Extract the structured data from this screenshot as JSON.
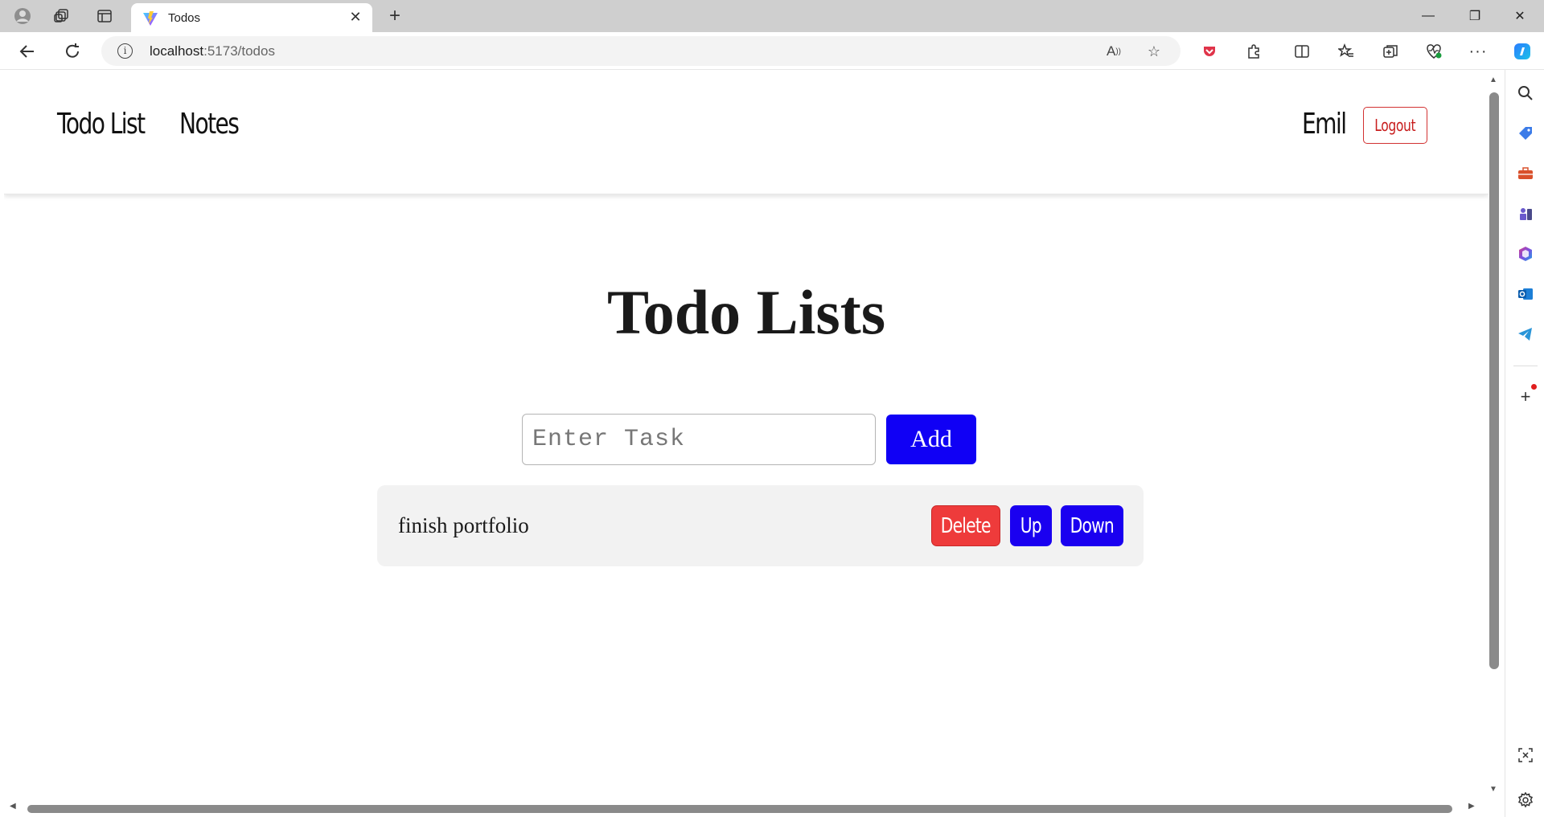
{
  "browser": {
    "tab_title": "Todos",
    "tab_close": "✕",
    "new_tab": "+",
    "address": {
      "host": "localhost",
      "port_path": ":5173/todos"
    },
    "window_controls": {
      "minimize": "—",
      "restore": "❐",
      "close": "✕"
    },
    "icons": [
      "profile-icon",
      "workspaces-icon",
      "tab-actions-icon",
      "back-icon",
      "refresh-icon",
      "site-info-icon",
      "read-aloud-icon",
      "favorite-star-icon",
      "pocket-icon",
      "extensions-icon",
      "split-screen-icon",
      "favorites-icon",
      "collections-icon",
      "browser-essentials-icon",
      "more-icon",
      "copilot-icon"
    ],
    "sidebar_icons": [
      "search-icon",
      "tag-icon",
      "toolbox-icon",
      "games-icon",
      "office-icon",
      "outlook-icon",
      "telegram-icon",
      "add-icon",
      "screenshot-icon",
      "settings-icon"
    ]
  },
  "nav": {
    "links": [
      "Todo List",
      "Notes"
    ],
    "user": "Emil",
    "logout": "Logout"
  },
  "main": {
    "title": "Todo Lists",
    "input_placeholder": "Enter Task",
    "add_label": "Add",
    "todos": [
      {
        "text": "finish portfolio",
        "delete": "Delete",
        "up": "Up",
        "down": "Down"
      }
    ]
  },
  "colors": {
    "primary_button": "#1000f5",
    "delete_button": "#ee3b3b",
    "logout_border": "#d23232",
    "todo_bg": "#f2f2f2"
  }
}
